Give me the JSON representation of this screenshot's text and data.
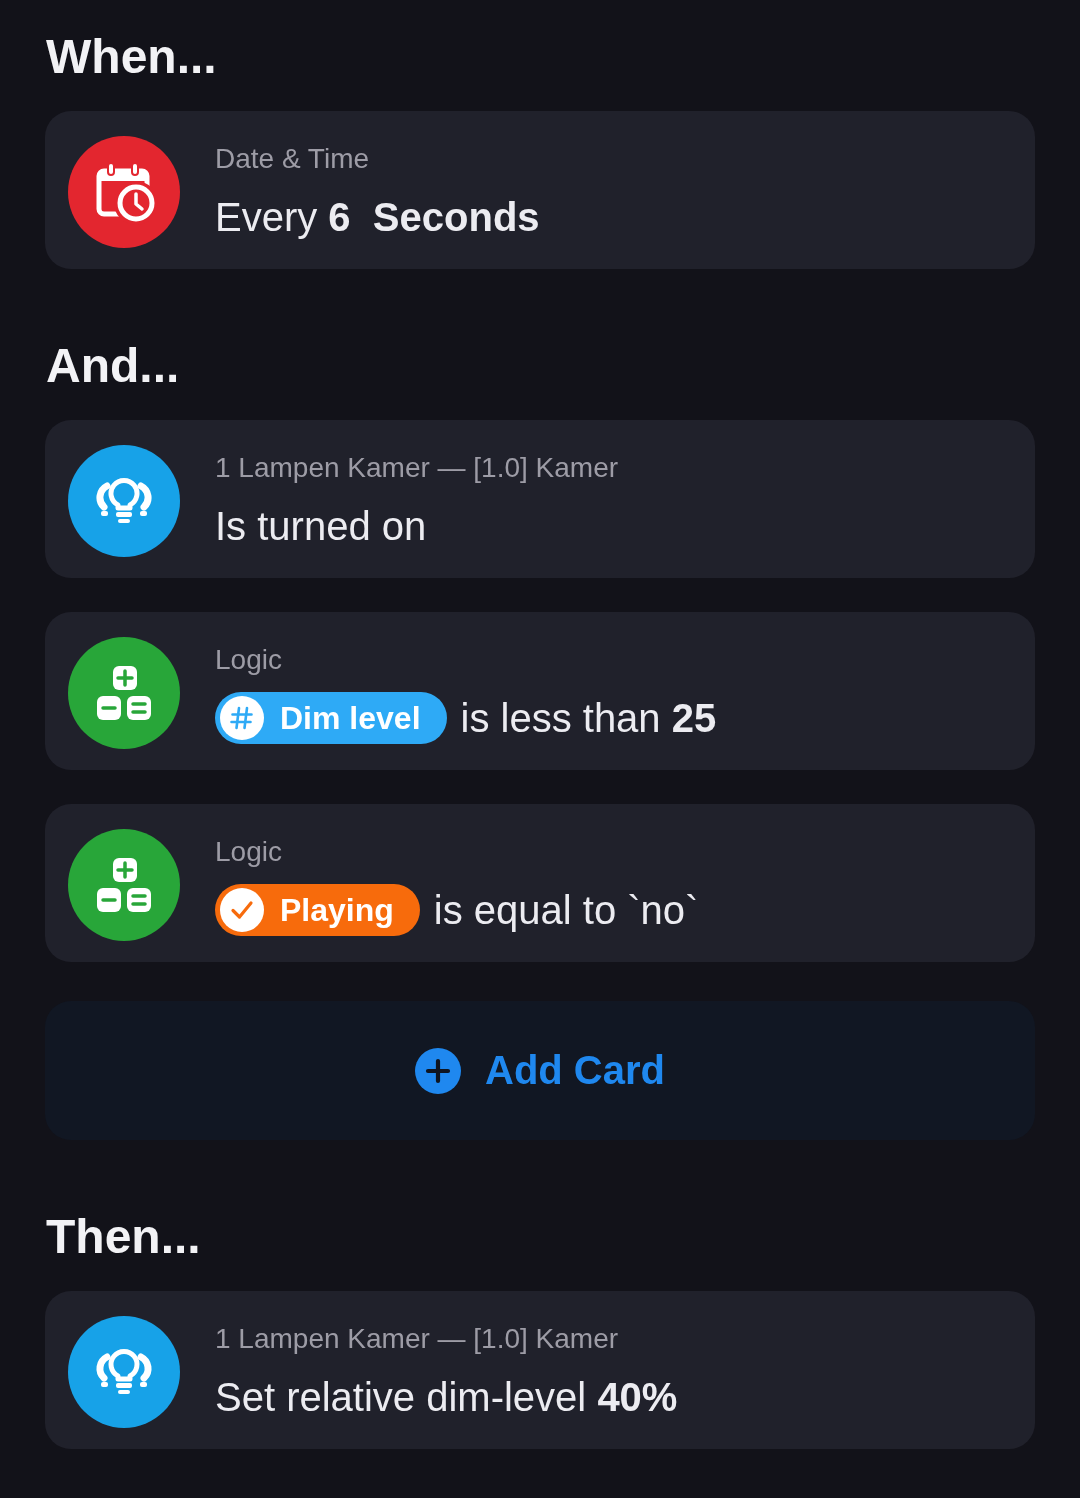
{
  "sections": [
    {
      "heading": "When...",
      "cards": [
        {
          "kind": "datetime",
          "color": "#e3262f",
          "subtitle": "Date & Time",
          "description": "Every **6**  **Seconds**"
        }
      ]
    },
    {
      "heading": "And...",
      "cards": [
        {
          "kind": "device",
          "color": "#17a2e8",
          "subtitle": "1 Lampen Kamer — [1.0] Kamer",
          "description": "Is turned on"
        },
        {
          "kind": "logic",
          "color": "#28a639",
          "subtitle": "Logic",
          "tag": {
            "kind": "number",
            "color": "#2eaaf6",
            "label": "Dim level"
          },
          "description": "is less than **25**"
        },
        {
          "kind": "logic",
          "color": "#28a639",
          "subtitle": "Logic",
          "tag": {
            "kind": "boolean",
            "color": "#f76b0c",
            "label": "Playing"
          },
          "description": "is equal to `no`"
        }
      ],
      "add_button": {
        "label": "Add Card"
      }
    },
    {
      "heading": "Then...",
      "cards": [
        {
          "kind": "device",
          "color": "#17a2e8",
          "subtitle": "1 Lampen Kamer — [1.0] Kamer",
          "description": "Set relative dim-level **40%**"
        }
      ]
    }
  ]
}
